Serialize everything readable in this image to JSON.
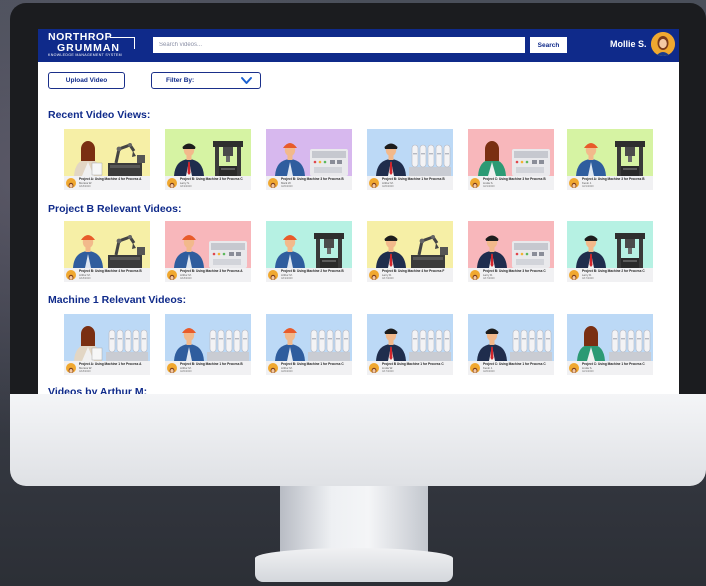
{
  "app": {
    "logo_top": "NORTHROP",
    "logo_bottom": "GRUMMAN",
    "logo_sub": "KNOWLEDGE MANAGEMENT SYSTEM"
  },
  "header": {
    "search_placeholder": "Search videos...",
    "search_button": "Search",
    "username": "Mollie S."
  },
  "toolbar": {
    "upload_label": "Upload Video",
    "filter_label": "Filter By:"
  },
  "colors": {
    "brand": "#0f2a8a",
    "thumb_yellow": "#f6efa6",
    "thumb_green": "#d6f3a3",
    "thumb_purple": "#d7b8ee",
    "thumb_blue": "#bcd9f6",
    "thumb_pink": "#f8b7bb",
    "thumb_mint": "#b6f1e3"
  },
  "sections": [
    {
      "title": "Recent Video Views:",
      "videos": [
        {
          "title": "Project A: Using Machine 4 for Process A",
          "author": "Monica W.",
          "date": "4/18/2020",
          "bg": "thumb_yellow",
          "person": "woman",
          "machine": "robot"
        },
        {
          "title": "Project B: Using Machine 3 for Process C",
          "author": "Larry S.",
          "date": "4/19/2020",
          "bg": "thumb_green",
          "person": "man-suit",
          "machine": "press"
        },
        {
          "title": "Project B: Using Machine 3 for Process B",
          "author": "Mark W.",
          "date": "4/20/2020",
          "bg": "thumb_purple",
          "person": "man-helmet",
          "machine": "panel"
        },
        {
          "title": "Project B: Using Machine 1 for Process B",
          "author": "Arthur M.",
          "date": "4/20/2020",
          "bg": "thumb_blue",
          "person": "man-suit",
          "machine": "tanks"
        },
        {
          "title": "Project C: Using Machine 3 for Process B",
          "author": "Linda S.",
          "date": "4/21/2020",
          "bg": "thumb_pink",
          "person": "woman-suit",
          "machine": "panel"
        },
        {
          "title": "Project A: Using Machine 3 for Process B",
          "author": "Kevin J.",
          "date": "4/21/2020",
          "bg": "thumb_green",
          "person": "man-helmet",
          "machine": "press"
        }
      ]
    },
    {
      "title": "Project B Relevant Videos:",
      "videos": [
        {
          "title": "Project B: Using Machine 4 for Process B",
          "author": "Arthur M.",
          "date": "4/18/2020",
          "bg": "thumb_yellow",
          "person": "man-helmet",
          "machine": "robot"
        },
        {
          "title": "Project B: Using Machine 3 for Process A",
          "author": "Arthur M.",
          "date": "4/18/2020",
          "bg": "thumb_pink",
          "person": "man-helmet",
          "machine": "panel"
        },
        {
          "title": "Project B: Using Machine 2 for Process B",
          "author": "Arthur M.",
          "date": "4/19/2020",
          "bg": "thumb_mint",
          "person": "man-helmet",
          "machine": "press"
        },
        {
          "title": "Project B: Using Machine 4 for Process F",
          "author": "Larry D.",
          "date": "4/17/2020",
          "bg": "thumb_yellow",
          "person": "man-suit",
          "machine": "robot"
        },
        {
          "title": "Project B: Using Machine 3 for Process C",
          "author": "Larry D.",
          "date": "4/17/2020",
          "bg": "thumb_pink",
          "person": "man-suit",
          "machine": "panel"
        },
        {
          "title": "Project B: Using Machine 2 for Process C",
          "author": "Larry D.",
          "date": "4/17/2020",
          "bg": "thumb_mint",
          "person": "man-suit",
          "machine": "press"
        }
      ]
    },
    {
      "title": "Machine 1 Relevant Videos:",
      "videos": [
        {
          "title": "Project A: Using Machine 1 for Process A",
          "author": "Monica W.",
          "date": "4/18/2020",
          "bg": "thumb_blue",
          "person": "woman",
          "machine": "tanks"
        },
        {
          "title": "Project B: Using Machine 1 for Process B",
          "author": "Arthur M.",
          "date": "4/20/2020",
          "bg": "thumb_blue",
          "person": "man-helmet",
          "machine": "tanks"
        },
        {
          "title": "Project B: Using Machine 1 for Process C",
          "author": "Arthur M.",
          "date": "4/20/2020",
          "bg": "thumb_blue",
          "person": "man-helmet",
          "machine": "tanks"
        },
        {
          "title": "Project B Using Machine 1 for Process C",
          "author": "Linda W.",
          "date": "4/17/2020",
          "bg": "thumb_blue",
          "person": "man-suit",
          "machine": "tanks"
        },
        {
          "title": "Project C: Using Machine 1 for Process C",
          "author": "Kevin J.",
          "date": "4/20/2020",
          "bg": "thumb_blue",
          "person": "man-suit",
          "machine": "tanks"
        },
        {
          "title": "Project C: Using Machine 1 for Process C",
          "author": "Linda S.",
          "date": "4/21/2020",
          "bg": "thumb_blue",
          "person": "woman-suit",
          "machine": "tanks"
        }
      ]
    },
    {
      "title": "Videos by Arthur M:",
      "videos": []
    }
  ]
}
